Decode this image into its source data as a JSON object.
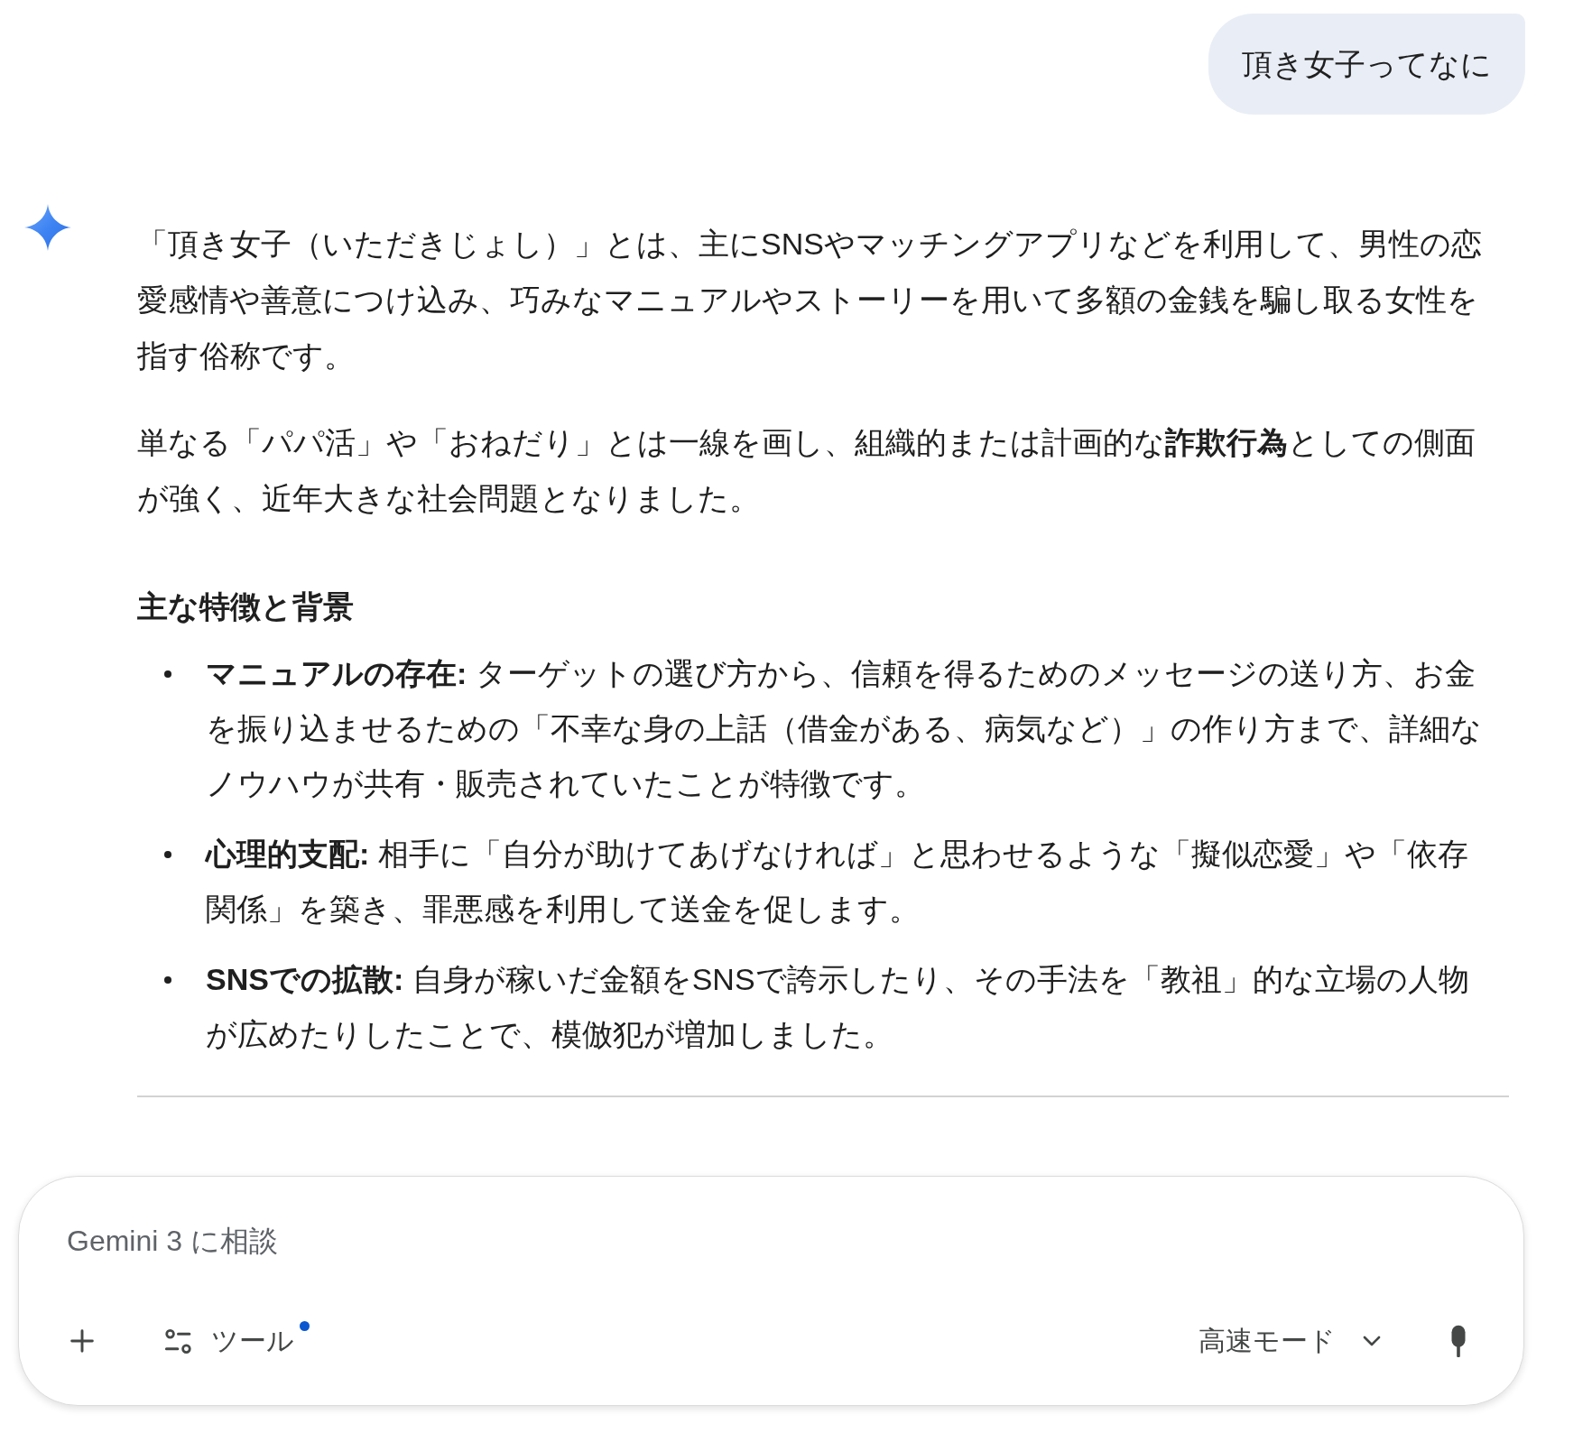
{
  "user_message": {
    "text": "頂き女子ってなに"
  },
  "response": {
    "blocks": [
      {
        "kind": "paragraph",
        "text": "「頂き女子（いただきじょし）」とは、主にSNSやマッチングアプリなどを利用して、男性の恋愛感情や善意につけ込み、巧みなマニュアルやストーリーを用いて多額の金銭を騙し取る女性を指す俗称です。"
      },
      {
        "kind": "paragraph",
        "text": "単なる「パパ活」や「おねだり」とは一線を画し、組織的または計画的な**詐欺行為**としての側面が強く、近年大きな社会問題となりました。"
      },
      {
        "kind": "heading",
        "text": "主な特徴と背景"
      },
      {
        "kind": "bullets",
        "items": [
          "**マニュアルの存在:** ターゲットの選び方から、信頼を得るためのメッセージの送り方、お金を振り込ませるための「不幸な身の上話（借金がある、病気など）」の作り方まで、詳細なノウハウが共有・販売されていたことが特徴です。",
          "**心理的支配:** 相手に「自分が助けてあげなければ」と思わせるような「擬似恋愛」や「依存関係」を築き、罪悪感を利用して送金を促します。",
          "**SNSでの拡散:** 自身が稼いだ金額をSNSで誇示したり、その手法を「教祖」的な立場の人物が広めたりしたことで、模倣犯が増加しました。"
        ]
      }
    ]
  },
  "prompt_box": {
    "placeholder": "Gemini 3 に相談",
    "tools_label": "ツール",
    "tools_notice": true,
    "mode_label": "高速モード"
  }
}
